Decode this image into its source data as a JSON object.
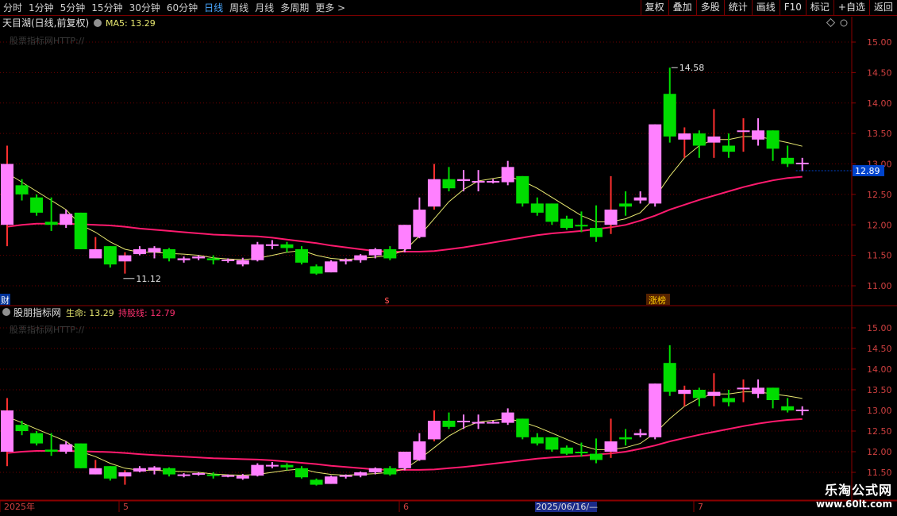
{
  "toolbar": {
    "periods": [
      "分时",
      "1分钟",
      "5分钟",
      "15分钟",
      "30分钟",
      "60分钟",
      "日线",
      "周线",
      "月线",
      "多周期",
      "更多 >"
    ],
    "active_period": "日线",
    "tools": [
      "复权",
      "叠加",
      "多股",
      "统计",
      "画线",
      "F10",
      "标记",
      "+自选",
      "返回"
    ]
  },
  "panel1": {
    "title": "天目湖(日线,前复权)",
    "ma_label": "MA5: 13.29",
    "watermark": "股票指标网HTTP://",
    "max_label": "14.58",
    "min_label": "11.12",
    "price_badge": "12.89",
    "markers": [
      "财",
      "$",
      "涨榜"
    ]
  },
  "panel2": {
    "title": "股朋指标网",
    "life_label": "生命: 13.29",
    "hold_label": "持股线: 12.79",
    "watermark": "股票指标网HTTP://"
  },
  "date_axis": {
    "labels": [
      "2025年",
      "5",
      "6",
      "2025/06/16/—",
      "7"
    ]
  },
  "branding": {
    "title": "乐淘公式网",
    "url": "www.60lt.com"
  },
  "colors": {
    "up": "#ff80ff",
    "down": "#00dd00",
    "ma": "#e8e870",
    "trend": "#ff1a6e",
    "axis": "#8b0000"
  },
  "chart_data": {
    "type": "candlestick",
    "y_range": [
      10.8,
      15.3
    ],
    "y_ticks": [
      11.0,
      11.5,
      12.0,
      12.5,
      13.0,
      13.5,
      14.0,
      14.5,
      15.0
    ],
    "panel2_y_ticks": [
      11.5,
      12.0,
      12.5,
      13.0,
      13.5,
      14.0,
      14.5,
      15.0
    ],
    "candles": [
      [
        12.0,
        13.0,
        11.65,
        13.3
      ],
      [
        12.65,
        12.5,
        12.4,
        12.75
      ],
      [
        12.45,
        12.2,
        12.15,
        12.5
      ],
      [
        12.05,
        12.0,
        11.9,
        12.45
      ],
      [
        12.0,
        12.18,
        11.95,
        12.25
      ],
      [
        12.2,
        11.6,
        11.6,
        12.2
      ],
      [
        11.45,
        11.6,
        11.45,
        11.8
      ],
      [
        11.65,
        11.35,
        11.3,
        11.65
      ],
      [
        11.4,
        11.5,
        11.2,
        11.55
      ],
      [
        11.52,
        11.6,
        11.5,
        11.65
      ],
      [
        11.55,
        11.62,
        11.45,
        11.65
      ],
      [
        11.6,
        11.45,
        11.4,
        11.62
      ],
      [
        11.42,
        11.45,
        11.38,
        11.48
      ],
      [
        11.45,
        11.48,
        11.42,
        11.5
      ],
      [
        11.45,
        11.42,
        11.35,
        11.5
      ],
      [
        11.42,
        11.43,
        11.38,
        11.45
      ],
      [
        11.35,
        11.42,
        11.32,
        11.46
      ],
      [
        11.42,
        11.68,
        11.4,
        11.72
      ],
      [
        11.68,
        11.68,
        11.6,
        11.75
      ],
      [
        11.68,
        11.62,
        11.55,
        11.72
      ],
      [
        11.6,
        11.38,
        11.35,
        11.65
      ],
      [
        11.32,
        11.2,
        11.18,
        11.35
      ],
      [
        11.22,
        11.4,
        11.22,
        11.42
      ],
      [
        11.4,
        11.43,
        11.35,
        11.45
      ],
      [
        11.42,
        11.5,
        11.38,
        11.52
      ],
      [
        11.5,
        11.6,
        11.45,
        11.62
      ],
      [
        11.6,
        11.45,
        11.42,
        11.65
      ],
      [
        11.6,
        12.0,
        11.55,
        12.0
      ],
      [
        11.8,
        12.25,
        11.78,
        12.45
      ],
      [
        12.3,
        12.75,
        12.25,
        13.0
      ],
      [
        12.75,
        12.6,
        12.55,
        12.95
      ],
      [
        12.72,
        12.75,
        12.55,
        12.9
      ],
      [
        12.72,
        12.72,
        12.55,
        12.9
      ],
      [
        12.7,
        12.72,
        12.68,
        12.75
      ],
      [
        12.7,
        12.95,
        12.65,
        13.05
      ],
      [
        12.8,
        12.35,
        12.3,
        12.8
      ],
      [
        12.35,
        12.2,
        12.15,
        12.45
      ],
      [
        12.35,
        12.05,
        12.0,
        12.35
      ],
      [
        12.1,
        11.95,
        11.92,
        12.15
      ],
      [
        12.0,
        11.98,
        11.88,
        12.22
      ],
      [
        11.95,
        11.8,
        11.72,
        12.32
      ],
      [
        12.0,
        12.25,
        11.85,
        12.8
      ],
      [
        12.35,
        12.3,
        12.15,
        12.55
      ],
      [
        12.4,
        12.45,
        12.35,
        12.55
      ],
      [
        12.35,
        13.65,
        12.3,
        13.65
      ],
      [
        14.15,
        13.45,
        13.35,
        14.58
      ],
      [
        13.4,
        13.5,
        13.1,
        13.6
      ],
      [
        13.5,
        13.3,
        13.1,
        13.55
      ],
      [
        13.35,
        13.45,
        13.1,
        13.9
      ],
      [
        13.3,
        13.2,
        13.1,
        13.5
      ],
      [
        13.55,
        13.55,
        13.2,
        13.75
      ],
      [
        13.4,
        13.55,
        13.3,
        13.75
      ],
      [
        13.55,
        13.25,
        13.05,
        13.55
      ],
      [
        13.1,
        13.0,
        12.95,
        13.3
      ],
      [
        13.0,
        13.02,
        12.88,
        13.1
      ]
    ],
    "ma5": [
      12.85,
      12.7,
      12.55,
      12.4,
      12.25,
      12.0,
      11.88,
      11.72,
      11.6,
      11.55,
      11.55,
      11.53,
      11.52,
      11.5,
      11.46,
      11.44,
      11.43,
      11.45,
      11.5,
      11.55,
      11.58,
      11.5,
      11.45,
      11.43,
      11.45,
      11.47,
      11.5,
      11.58,
      11.82,
      12.1,
      12.38,
      12.58,
      12.72,
      12.76,
      12.8,
      12.72,
      12.6,
      12.45,
      12.3,
      12.15,
      12.05,
      12.05,
      12.1,
      12.2,
      12.45,
      12.8,
      13.1,
      13.3,
      13.4,
      13.4,
      13.45,
      13.45,
      13.4,
      13.35,
      13.29
    ],
    "trend": [
      11.97,
      12.0,
      12.02,
      12.02,
      12.02,
      12.01,
      12.0,
      11.99,
      11.97,
      11.94,
      11.92,
      11.9,
      11.88,
      11.86,
      11.84,
      11.83,
      11.82,
      11.81,
      11.79,
      11.76,
      11.73,
      11.7,
      11.66,
      11.63,
      11.6,
      11.57,
      11.56,
      11.56,
      11.56,
      11.57,
      11.6,
      11.63,
      11.67,
      11.71,
      11.75,
      11.79,
      11.83,
      11.86,
      11.88,
      11.9,
      11.93,
      11.96,
      12.0,
      12.07,
      12.15,
      12.25,
      12.33,
      12.41,
      12.48,
      12.55,
      12.62,
      12.68,
      12.73,
      12.77,
      12.79
    ]
  }
}
